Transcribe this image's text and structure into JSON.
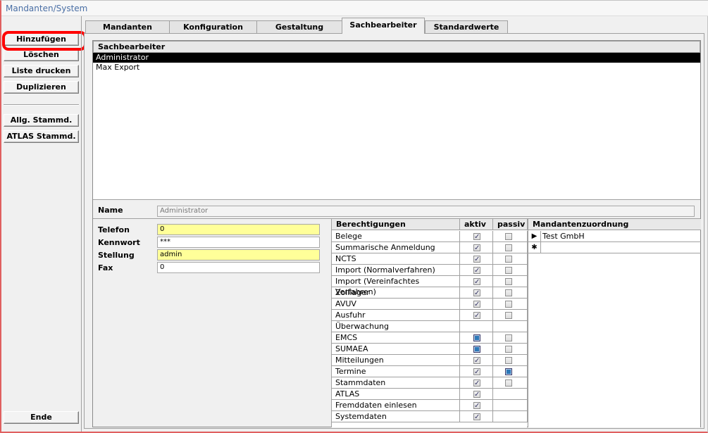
{
  "window": {
    "title": "Mandanten/System"
  },
  "leftbar": {
    "buttons": [
      "Hinzufügen",
      "Löschen",
      "Liste drucken",
      "Duplizieren"
    ],
    "buttons2": [
      "Allg. Stammd.",
      "ATLAS Stammd."
    ],
    "end": "Ende"
  },
  "tabs": [
    "Mandanten",
    "Konfiguration",
    "Gestaltung",
    "Sachbearbeiter",
    "Standardwerte"
  ],
  "active_tab": "Sachbearbeiter",
  "list": {
    "header": "Sachbearbeiter",
    "items": [
      "Administrator",
      "Max Export"
    ],
    "selected": "Administrator"
  },
  "form": {
    "name_label": "Name",
    "name_value": "Administrator",
    "telefon_label": "Telefon",
    "telefon_value": "0",
    "kennwort_label": "Kennwort",
    "kennwort_value": "***",
    "stellung_label": "Stellung",
    "stellung_value": "admin",
    "fax_label": "Fax",
    "fax_value": "0"
  },
  "rights": {
    "headers": [
      "Berechtigungen",
      "aktiv",
      "passiv"
    ],
    "rows": [
      {
        "name": "Belege",
        "aktiv": "checked",
        "passiv": "unchecked"
      },
      {
        "name": "Summarische Anmeldung",
        "aktiv": "checked",
        "passiv": "unchecked"
      },
      {
        "name": "NCTS",
        "aktiv": "checked",
        "passiv": "unchecked"
      },
      {
        "name": "Import (Normalverfahren)",
        "aktiv": "checked",
        "passiv": "unchecked"
      },
      {
        "name": "Import (Vereinfachtes Verfahren)",
        "aktiv": "checked",
        "passiv": "unchecked"
      },
      {
        "name": "Zolllager",
        "aktiv": "checked",
        "passiv": "unchecked"
      },
      {
        "name": "AVUV",
        "aktiv": "checked",
        "passiv": "unchecked"
      },
      {
        "name": "Ausfuhr",
        "aktiv": "checked",
        "passiv": "unchecked"
      },
      {
        "name": "Überwachung",
        "aktiv": "none",
        "passiv": "none"
      },
      {
        "name": "EMCS",
        "aktiv": "filled",
        "passiv": "unchecked"
      },
      {
        "name": "SUMAEA",
        "aktiv": "filled",
        "passiv": "unchecked"
      },
      {
        "name": "Mitteilungen",
        "aktiv": "checked",
        "passiv": "unchecked"
      },
      {
        "name": "Termine",
        "aktiv": "checked",
        "passiv": "filled"
      },
      {
        "name": "Stammdaten",
        "aktiv": "checked",
        "passiv": "unchecked"
      },
      {
        "name": "ATLAS",
        "aktiv": "checked",
        "passiv": "none"
      },
      {
        "name": "Fremddaten einlesen",
        "aktiv": "checked",
        "passiv": "none"
      },
      {
        "name": "Systemdaten",
        "aktiv": "checked",
        "passiv": "none"
      }
    ]
  },
  "mandanten": {
    "header": "Mandantenzuordnung",
    "rows": [
      "Test GmbH"
    ],
    "current_marker": "▶",
    "new_marker": "✱"
  },
  "colors": {
    "highlight": "#ff0000",
    "selected_row": "#000000",
    "required_field": "#ffff99",
    "filled_checkbox": "#2d78b8"
  }
}
